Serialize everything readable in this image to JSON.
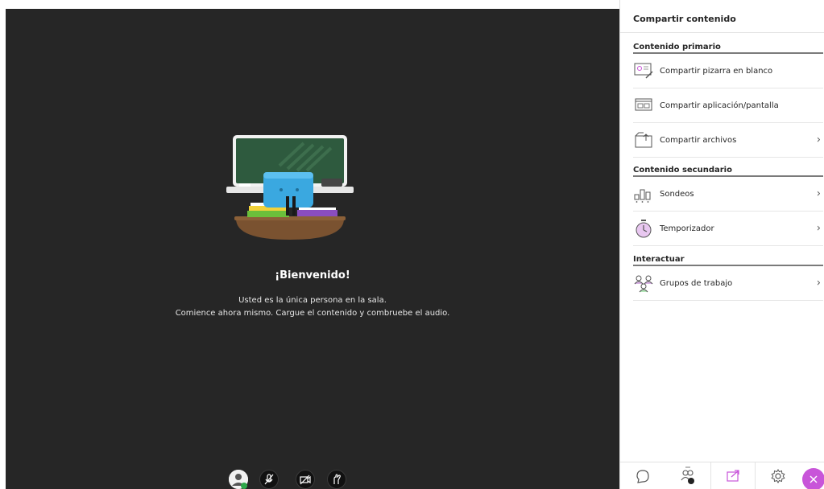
{
  "stage": {
    "welcome_title": "¡Bienvenido!",
    "welcome_line1": "Usted es la única persona en la sala.",
    "welcome_line2": "Comience ahora mismo. Cargue el contenido y combruebe el audio."
  },
  "media_bar": {
    "buttons": [
      {
        "icon": "avatar-icon"
      },
      {
        "icon": "microphone-off-icon"
      },
      {
        "icon": "camera-off-icon"
      },
      {
        "icon": "raise-hand-icon"
      }
    ]
  },
  "panel": {
    "title": "Compartir contenido",
    "sections": [
      {
        "title": "Contenido primario",
        "items": [
          {
            "label": "Compartir pizarra en blanco",
            "icon": "whiteboard-icon",
            "chevron": ""
          },
          {
            "label": "Compartir aplicación/pantalla",
            "icon": "screen-share-icon",
            "chevron": ""
          },
          {
            "label": "Compartir archivos",
            "icon": "files-icon",
            "chevron": "›"
          }
        ]
      },
      {
        "title": "Contenido secundario",
        "items": [
          {
            "label": "Sondeos",
            "icon": "poll-icon",
            "chevron": "›"
          },
          {
            "label": "Temporizador",
            "icon": "timer-icon",
            "chevron": "›"
          }
        ]
      },
      {
        "title": "Interactuar",
        "items": [
          {
            "label": "Grupos de trabajo",
            "icon": "breakout-groups-icon",
            "chevron": "›"
          }
        ]
      }
    ]
  },
  "tabs": [
    {
      "icon": "chat-icon",
      "active": false
    },
    {
      "icon": "attendees-icon",
      "active": false
    },
    {
      "icon": "share-content-icon",
      "active": true
    },
    {
      "icon": "settings-icon",
      "active": false
    }
  ],
  "colors": {
    "stage_bg": "#262626",
    "accent_purple": "#c855d9",
    "status_green": "#2ea84a"
  }
}
